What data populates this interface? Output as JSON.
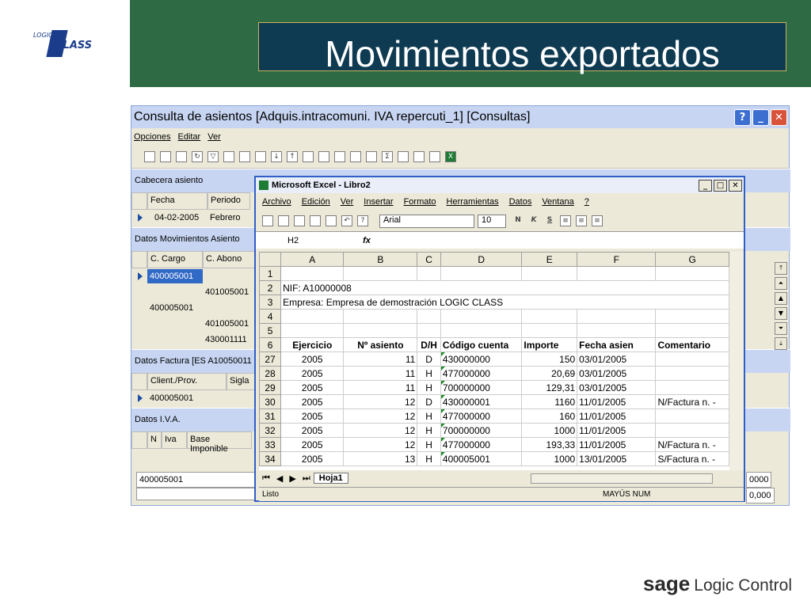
{
  "slide": {
    "title": "Movimientos exportados",
    "logo_small": "LOGIC",
    "logo_big": "CLASS",
    "footer_brand": "sage",
    "footer_text": "Logic Control"
  },
  "main_window": {
    "title": "Consulta de asientos [Adquis.intracomuni. IVA repercuti_1] [Consultas]",
    "menu": [
      "Opciones",
      "Editar",
      "Ver"
    ],
    "cabecera": {
      "label": "Cabecera asiento",
      "headers": [
        "Fecha",
        "Periodo"
      ],
      "row": [
        "04-02-2005",
        "Febrero"
      ]
    },
    "movimientos": {
      "label": "Datos Movimientos Asiento",
      "headers": [
        "C. Cargo",
        "C. Abono"
      ],
      "rows": [
        [
          "400005001",
          ""
        ],
        [
          "",
          "401005001"
        ],
        [
          "400005001",
          ""
        ],
        [
          "",
          "401005001"
        ],
        [
          "",
          "430001111"
        ]
      ]
    },
    "factura": {
      "label": "Datos Factura [ES A10050011",
      "headers": [
        "Client./Prov.",
        "Sigla"
      ],
      "row": [
        "400005001"
      ]
    },
    "iva": {
      "label": "Datos I.V.A.",
      "headers": [
        "N",
        "Iva",
        "Base Imponible"
      ]
    },
    "bottom_field": "400005001",
    "right_values": [
      "0000",
      "0,000"
    ]
  },
  "excel": {
    "title": "Microsoft Excel - Libro2",
    "menu": [
      "Archivo",
      "Edición",
      "Ver",
      "Insertar",
      "Formato",
      "Herramientas",
      "Datos",
      "Ventana",
      "?"
    ],
    "font": "Arial",
    "size": "10",
    "name_box": "H2",
    "fx": "fx",
    "columns": [
      "A",
      "B",
      "C",
      "D",
      "E",
      "F",
      "G"
    ],
    "rows": [
      {
        "n": "1",
        "cells": [
          "",
          "",
          "",
          "",
          "",
          "",
          ""
        ]
      },
      {
        "n": "2",
        "text": "NIF: A10000008"
      },
      {
        "n": "3",
        "text": "Empresa: Empresa de demostración LOGIC CLASS"
      },
      {
        "n": "4",
        "cells": [
          "",
          "",
          "",
          "",
          "",
          "",
          ""
        ]
      },
      {
        "n": "5",
        "cells": [
          "",
          "",
          "",
          "",
          "",
          "",
          ""
        ]
      },
      {
        "n": "6",
        "cells": [
          "Ejercicio",
          "Nº asiento",
          "D/H",
          "Código cuenta",
          "Importe",
          "Fecha asien",
          "Comentario"
        ]
      },
      {
        "n": "27",
        "cells": [
          "2005",
          "11",
          "D",
          "430000000",
          "150",
          "03/01/2005",
          ""
        ]
      },
      {
        "n": "28",
        "cells": [
          "2005",
          "11",
          "H",
          "477000000",
          "20,69",
          "03/01/2005",
          ""
        ]
      },
      {
        "n": "29",
        "cells": [
          "2005",
          "11",
          "H",
          "700000000",
          "129,31",
          "03/01/2005",
          ""
        ]
      },
      {
        "n": "30",
        "cells": [
          "2005",
          "12",
          "D",
          "430000001",
          "1160",
          "11/01/2005",
          "N/Factura n.  -"
        ]
      },
      {
        "n": "31",
        "cells": [
          "2005",
          "12",
          "H",
          "477000000",
          "160",
          "11/01/2005",
          ""
        ]
      },
      {
        "n": "32",
        "cells": [
          "2005",
          "12",
          "H",
          "700000000",
          "1000",
          "11/01/2005",
          ""
        ]
      },
      {
        "n": "33",
        "cells": [
          "2005",
          "12",
          "H",
          "477000000",
          "193,33",
          "11/01/2005",
          "N/Factura n.  -"
        ]
      },
      {
        "n": "34",
        "cells": [
          "2005",
          "13",
          "H",
          "400005001",
          "1000",
          "13/01/2005",
          "S/Factura n.  -"
        ]
      }
    ],
    "sheet_tab": "Hoja1",
    "status_left": "Listo",
    "status_right": "MAYÚS NUM"
  }
}
